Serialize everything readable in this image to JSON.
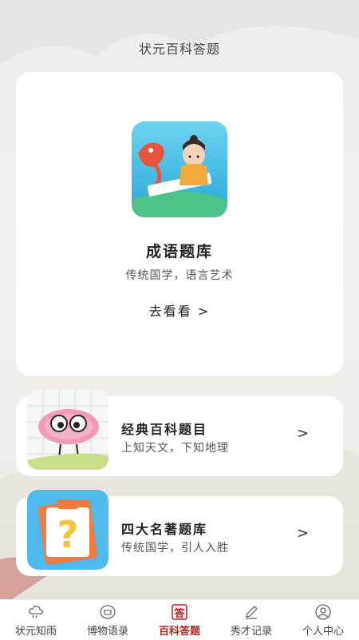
{
  "header": {
    "title": "状元百科答题"
  },
  "hero": {
    "title": "成语题库",
    "subtitle": "传统国学，语言艺术",
    "link_label": "去看看",
    "link_arrow": ">"
  },
  "rows": [
    {
      "title": "经典百科题目",
      "subtitle": "上知天文，下知地理",
      "arrow": ">"
    },
    {
      "title": "四大名著题库",
      "subtitle": "传统国学，引人入胜",
      "arrow": ">"
    }
  ],
  "tabbar": {
    "tabs": [
      {
        "label": "状元知雨",
        "icon": "cloud-rain-icon"
      },
      {
        "label": "博物语录",
        "icon": "museum-icon"
      },
      {
        "label": "百科答题",
        "icon": "answer-stamp-icon",
        "active": true
      },
      {
        "label": "秀才记录",
        "icon": "pencil-icon"
      },
      {
        "label": "个人中心",
        "icon": "user-icon"
      }
    ],
    "icon_char_active": "答"
  },
  "colors": {
    "accent": "#b8241f",
    "card": "#ffffff",
    "background": "#efedea"
  }
}
